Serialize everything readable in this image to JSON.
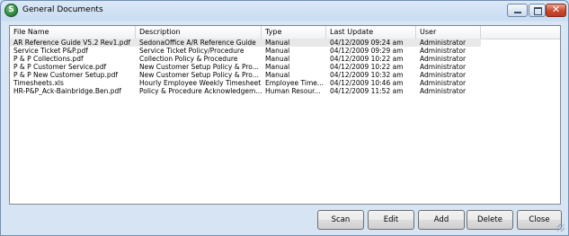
{
  "window": {
    "title": "General Documents",
    "icon_letter": "S"
  },
  "table": {
    "columns": [
      "File Name",
      "Description",
      "Type",
      "Last Update",
      "User"
    ],
    "rows": [
      [
        "AR Reference Guide V5.2 Rev1.pdf",
        "SedonaOffice A/R Reference Guide",
        "Manual",
        "04/12/2009 09:24 am",
        "Administrator"
      ],
      [
        "Service Ticket P&P.pdf",
        "Service Ticket Policy/Procedure",
        "Manual",
        "04/12/2009 09:29 am",
        "Administrator"
      ],
      [
        "P & P Collections.pdf",
        "Collection Policy & Procedure",
        "Manual",
        "04/12/2009 10:22 am",
        "Administrator"
      ],
      [
        "P & P Customer Service.pdf",
        "New Customer Setup Policy & Pro...",
        "Manual",
        "04/12/2009 10:22 am",
        "Administrator"
      ],
      [
        "P & P New Customer Setup.pdf",
        "New Customer Setup Policy & Pro...",
        "Manual",
        "04/12/2009 10:32 am",
        "Administrator"
      ],
      [
        "Timesheets.xls",
        "Hourly Employee Weekly Timesheet",
        "Employee Time...",
        "04/12/2009 10:46 am",
        "Administrator"
      ],
      [
        "HR-P&P_Ack-Bainbridge.Ben.pdf",
        "Policy & Procedure Acknowledgem...",
        "Human Resour...",
        "04/12/2009 11:52 am",
        "Administrator"
      ]
    ]
  },
  "buttons": {
    "scan": "Scan",
    "edit": "Edit",
    "add": "Add",
    "delete": "Delete",
    "close": "Close"
  },
  "colors": {
    "selected_row": "#e8e8e8",
    "close_button": "#c9482e"
  }
}
